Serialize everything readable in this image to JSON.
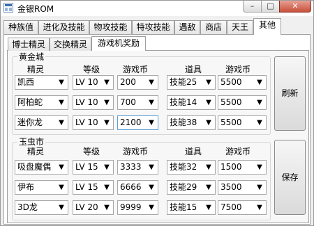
{
  "window": {
    "title": "金银ROM",
    "min": "–",
    "max": "□",
    "close": "✕"
  },
  "tabs": [
    "种族值",
    "进化及技能",
    "物攻技能",
    "特攻技能",
    "遇敌",
    "商店",
    "天王",
    "其他"
  ],
  "subtabs": [
    "博士精灵",
    "交换精灵",
    "游戏机奖励"
  ],
  "headers": {
    "pokemon": "精灵",
    "level": "等级",
    "coin": "游戏币",
    "item": "道具",
    "coin2": "游戏币"
  },
  "groups": [
    {
      "name": "黄金城",
      "button": "刷新",
      "rows": [
        {
          "pokemon": "凯西",
          "level": "LV 10",
          "coin": "200",
          "item": "技能25",
          "coin2": "5500"
        },
        {
          "pokemon": "阿柏蛇",
          "level": "LV 10",
          "coin": "700",
          "item": "技能14",
          "coin2": "5500"
        },
        {
          "pokemon": "迷你龙",
          "level": "LV 10",
          "coin": "2100",
          "item": "技能38",
          "coin2": "5500"
        }
      ]
    },
    {
      "name": "玉虫市",
      "button": "保存",
      "rows": [
        {
          "pokemon": "吸盘魔偶",
          "level": "LV 15",
          "coin": "3333",
          "item": "技能32",
          "coin2": "1500"
        },
        {
          "pokemon": "伊布",
          "level": "LV 15",
          "coin": "6666",
          "item": "技能29",
          "coin2": "3500"
        },
        {
          "pokemon": "3D龙",
          "level": "LV 20",
          "coin": "9999",
          "item": "技能15",
          "coin2": "7500"
        }
      ]
    }
  ],
  "icons": {
    "dropdown": "chevron-down-icon"
  }
}
